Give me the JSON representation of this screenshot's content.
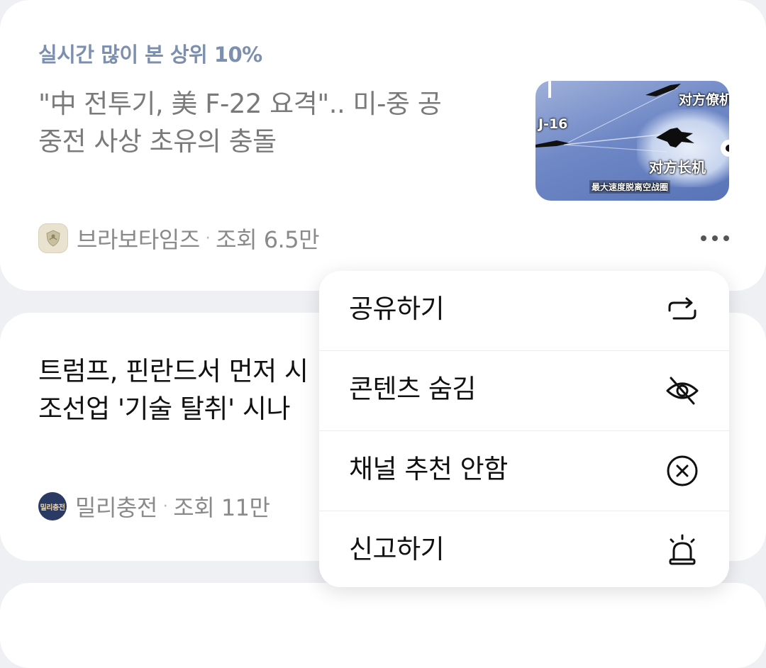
{
  "feed": [
    {
      "tag": "실시간 많이 본 상위 10%",
      "title_line1": "\"中 전투기, 美 F-22 요격\".. 미-중 공",
      "title_line2": "중전 사상 초유의 충돌",
      "source": "브라보타임즈",
      "separator": "·",
      "views": "조회 6.5만",
      "thumbnail": {
        "label_tl": "J-16",
        "label_tr": "对方僚机",
        "label_mid": "对方长机",
        "caption": "最大速度脱离空战圈"
      },
      "more_icon": "more-horizontal-icon"
    },
    {
      "title_line1": "트럼프, 핀란드서 먼저 시",
      "title_line2": "조선업 '기술 탈취' 시나",
      "source": "밀리충전",
      "source_logo_text": "밀리충전",
      "separator": "·",
      "views": "조회 11만"
    }
  ],
  "context_menu": {
    "items": [
      {
        "label": "공유하기",
        "icon": "share-icon"
      },
      {
        "label": "콘텐츠 숨김",
        "icon": "eye-off-icon"
      },
      {
        "label": "채널 추천 안함",
        "icon": "circle-x-icon"
      },
      {
        "label": "신고하기",
        "icon": "siren-icon"
      }
    ]
  },
  "colors": {
    "background": "#eef0f3",
    "card": "#ffffff",
    "tag": "#7d8fae",
    "meta_text": "#8a8a8a",
    "channel_logo": "#2b3a63"
  }
}
